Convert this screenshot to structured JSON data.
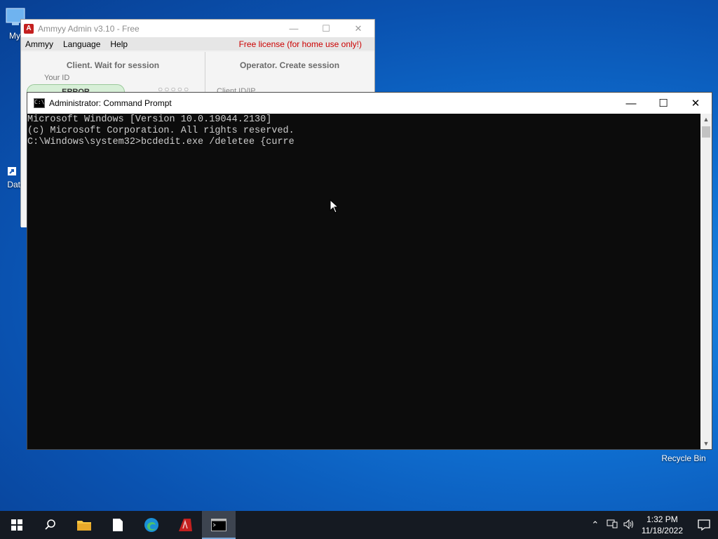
{
  "desktop": {
    "icons": [
      {
        "label": "My C"
      },
      {
        "label": "Data"
      },
      {
        "label": "Recycle Bin"
      }
    ]
  },
  "ammyy": {
    "title": "Ammyy Admin v3.10 - Free",
    "menu": [
      "Ammyy",
      "Language",
      "Help"
    ],
    "license": "Free license (for home use only!)",
    "client_title": "Client. Wait for session",
    "your_id_label": "Your ID",
    "your_id_value": "ERROR",
    "operator_title": "Operator. Create session",
    "client_id_label": "Client ID/IP"
  },
  "cmd": {
    "title": "Administrator: Command Prompt",
    "lines": [
      "Microsoft Windows [Version 10.0.19044.2130]",
      "(c) Microsoft Corporation. All rights reserved.",
      "",
      "C:\\Windows\\system32>bcdedit.exe /deletee {curre"
    ]
  },
  "taskbar": {
    "apps": [
      "start-icon",
      "search-icon",
      "file-explorer-icon",
      "notepad-icon",
      "edge-icon",
      "ammyy-icon",
      "cmd-icon"
    ],
    "time": "1:32 PM",
    "date": "11/18/2022"
  },
  "colors": {
    "console_bg": "#0c0c0c",
    "console_fg": "#cccccc",
    "taskbar_bg": "#151a22",
    "license_red": "#cc0000"
  }
}
